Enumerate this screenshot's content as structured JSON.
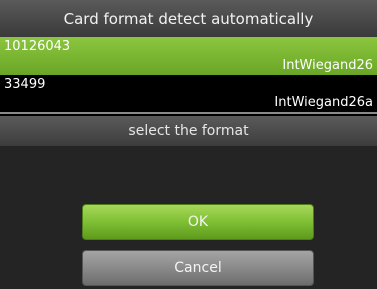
{
  "title": "Card format detect automatically",
  "cards": [
    {
      "number": "10126043",
      "format": "IntWiegand26",
      "selected": true
    },
    {
      "number": "33499",
      "format": "IntWiegand26a",
      "selected": false
    }
  ],
  "dialog": {
    "prompt": "select the format",
    "ok_label": "OK",
    "cancel_label": "Cancel"
  },
  "colors": {
    "selected_row": "#7ab632",
    "ok_button": "#7fbf34",
    "cancel_button": "#8a8a8a",
    "title_bar": "#4a4a4a"
  }
}
